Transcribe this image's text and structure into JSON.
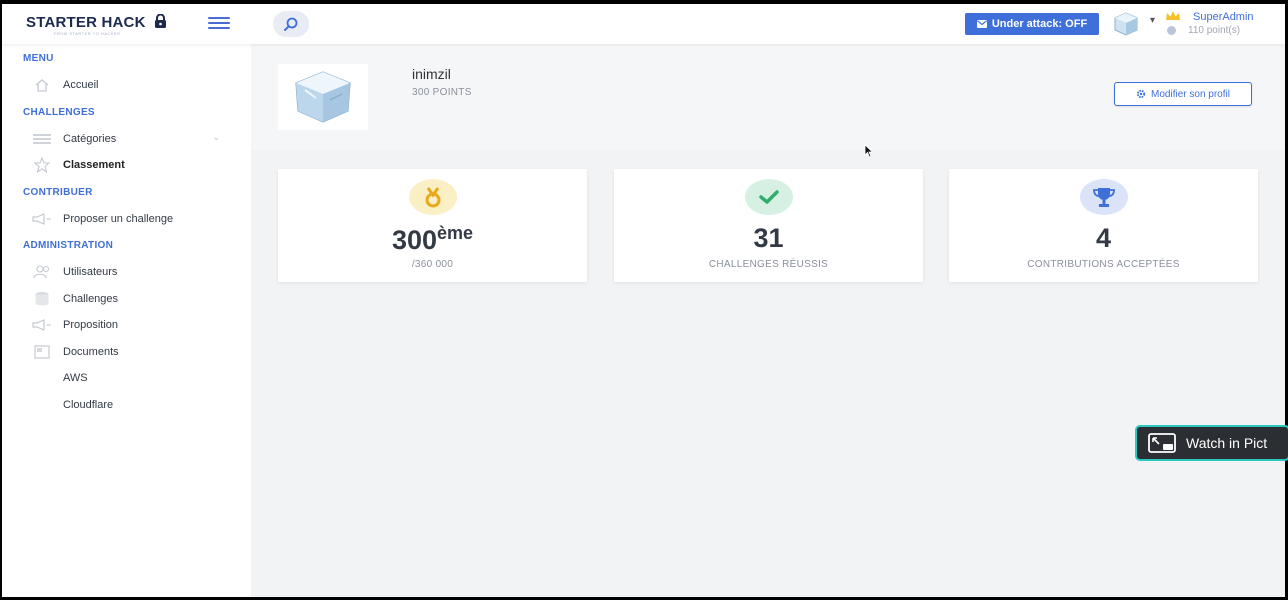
{
  "header": {
    "brand": "STARTER HACK",
    "brand_sub": "FROM STARTER TO HACKER",
    "attack_button": "Under attack: OFF",
    "user_name": "SuperAdmin",
    "user_points": "110 point(s)"
  },
  "sidebar": {
    "sections": [
      {
        "title": "MENU",
        "items": [
          {
            "label": "Accueil",
            "icon": "home-icon"
          }
        ]
      },
      {
        "title": "CHALLENGES",
        "items": [
          {
            "label": "Catégories",
            "icon": "list-icon"
          },
          {
            "label": "Classement",
            "icon": "star-icon"
          }
        ]
      },
      {
        "title": "CONTRIBUER",
        "items": [
          {
            "label": "Proposer un challenge",
            "icon": "megaphone-icon"
          }
        ]
      },
      {
        "title": "ADMINISTRATION",
        "items": [
          {
            "label": "Utilisateurs",
            "icon": "users-icon"
          },
          {
            "label": "Challenges",
            "icon": "database-icon"
          },
          {
            "label": "Proposition",
            "icon": "megaphone-icon"
          },
          {
            "label": "Documents",
            "icon": "document-icon"
          },
          {
            "label": "AWS"
          },
          {
            "label": "Cloudflare"
          }
        ]
      }
    ]
  },
  "profile": {
    "name": "inimzil",
    "points": "300 POINTS",
    "edit_button": "Modifier son profil"
  },
  "stats": [
    {
      "value": "300",
      "suffix": "ème",
      "label": "/360 000",
      "icon": "medal-icon",
      "icon_bg": "#fbefc6",
      "icon_color": "#e9a91a"
    },
    {
      "value": "31",
      "suffix": "",
      "label": "CHALLENGES RÉUSSIS",
      "icon": "check-icon",
      "icon_bg": "#d6f1e3",
      "icon_color": "#2fae6b"
    },
    {
      "value": "4",
      "suffix": "",
      "label": "CONTRIBUTIONS ACCEPTÉES",
      "icon": "trophy-icon",
      "icon_bg": "#dbe3f8",
      "icon_color": "#3f6fd8"
    }
  ],
  "overlay": {
    "pip_label": "Watch in Pict"
  },
  "colors": {
    "accent": "#3f6fd8",
    "brand": "#1d2a4f",
    "overlay_border": "#2bc8c0"
  }
}
